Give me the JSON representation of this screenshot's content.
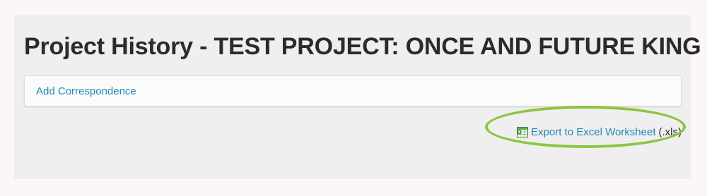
{
  "page": {
    "title": "Project History - TEST PROJECT: ONCE AND FUTURE KING"
  },
  "actions": {
    "add_correspondence_label": "Add Correspondence"
  },
  "export": {
    "icon": "excel-spreadsheet-icon",
    "link_label": "Export to Excel Worksheet",
    "suffix": "(.xls)"
  },
  "colors": {
    "link": "#1e88b8",
    "highlight": "#8cc640",
    "panel_background": "#efefef"
  }
}
